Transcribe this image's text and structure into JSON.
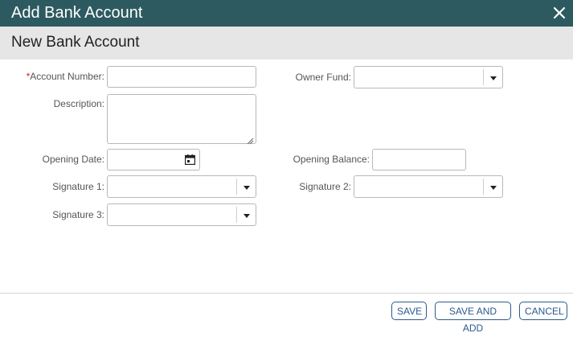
{
  "dialog": {
    "title": "Add Bank Account",
    "subtitle": "New Bank Account"
  },
  "form": {
    "account_number": {
      "required_mark": "*",
      "label": "Account Number:",
      "value": ""
    },
    "owner_fund": {
      "label": "Owner Fund:",
      "value": ""
    },
    "description": {
      "label": "Description:",
      "value": ""
    },
    "opening_date": {
      "label": "Opening Date:",
      "value": ""
    },
    "opening_balance": {
      "label": "Opening Balance:",
      "value": ""
    },
    "signature_1": {
      "label": "Signature 1:",
      "value": ""
    },
    "signature_2": {
      "label": "Signature 2:",
      "value": ""
    },
    "signature_3": {
      "label": "Signature 3:",
      "value": ""
    }
  },
  "footer": {
    "save": "SAVE",
    "save_and_add": "SAVE AND ADD",
    "cancel": "CANCEL"
  },
  "icons": {
    "close": "close-icon",
    "calendar": "calendar-icon",
    "dropdown": "chevron-down-icon"
  },
  "colors": {
    "titlebar": "#2d5a60",
    "subheader": "#e6e6e6",
    "required": "#cc2222",
    "button": "#2b5a8f"
  }
}
